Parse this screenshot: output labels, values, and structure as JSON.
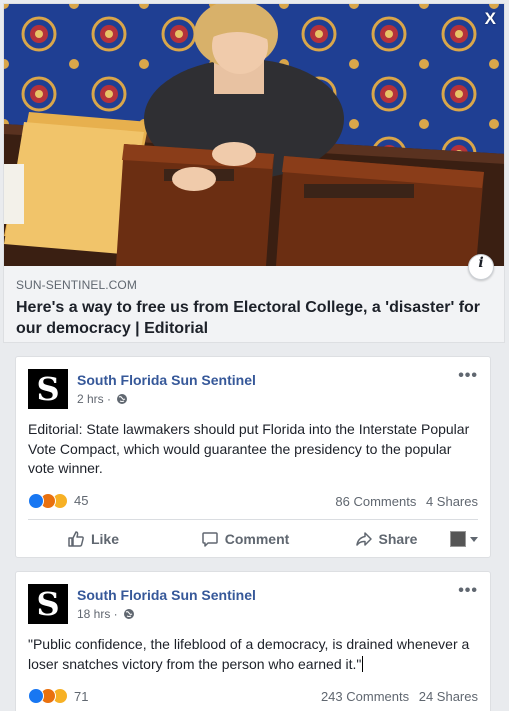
{
  "close_label": "X",
  "info_label": "i",
  "link_card": {
    "domain": "SUN-SENTINEL.COM",
    "title": "Here's a way to free us from Electoral College, a 'disaster' for our democracy | Editorial"
  },
  "posts": [
    {
      "page_name": "South Florida Sun Sentinel",
      "logo_letter": "S",
      "time": "2 hrs ·",
      "text": "Editorial: State lawmakers should put Florida into the Interstate Popular Vote Compact, which would guarantee the presidency to the popular vote winner.",
      "reaction_count": "45",
      "comments": "86 Comments",
      "shares": "4 Shares",
      "actions": {
        "like": "Like",
        "comment": "Comment",
        "share": "Share"
      }
    },
    {
      "page_name": "South Florida Sun Sentinel",
      "logo_letter": "S",
      "time": "18 hrs ·",
      "text": "\"Public confidence, the lifeblood of a democracy, is drained whenever a loser snatches victory from the person who earned it.\"",
      "reaction_count": "71",
      "comments": "243 Comments",
      "shares": "24 Shares"
    }
  ],
  "colors": {
    "page_name": "#365899",
    "like_blue": "#1877f2",
    "angry_orange": "#e9710f",
    "haha_yellow": "#f7b125",
    "carpet_blue": "#1f3f93"
  },
  "icons": [
    "close-icon",
    "info-icon",
    "globe-icon",
    "more-icon",
    "like-thumb-icon",
    "comment-bubble-icon",
    "share-arrow-icon",
    "caret-down-icon"
  ]
}
